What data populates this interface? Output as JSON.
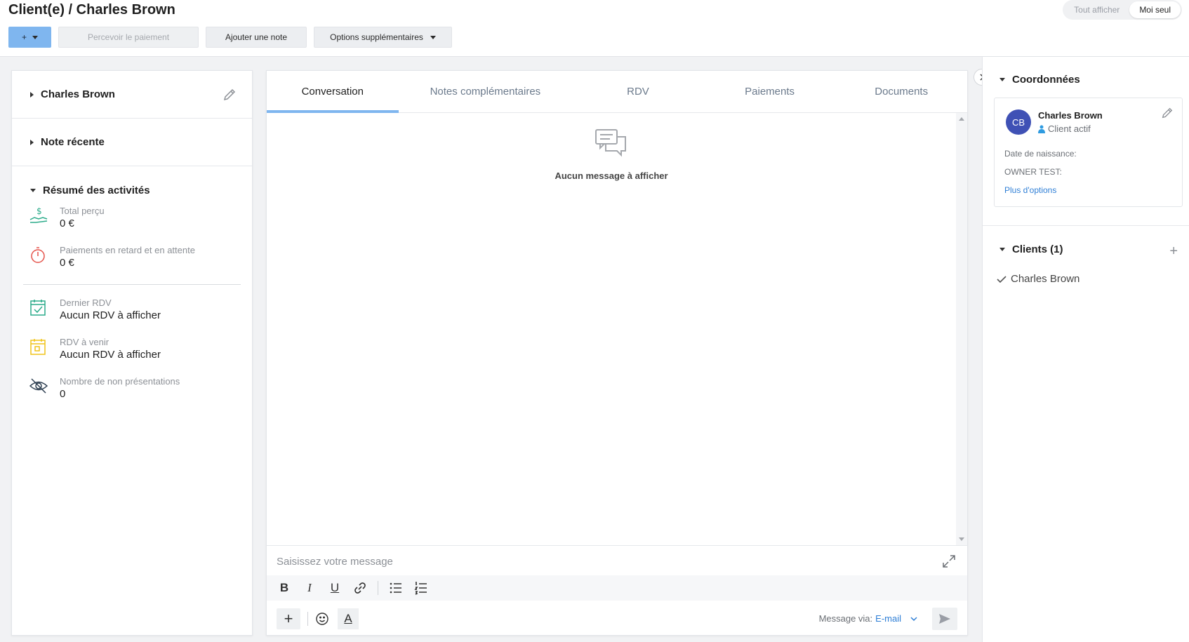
{
  "header": {
    "title": "Client(e) / Charles Brown",
    "view_toggle": {
      "show_all": "Tout afficher",
      "only_me": "Moi seul",
      "selected": "Moi seul"
    }
  },
  "toolbar": {
    "add_label": "+",
    "collect_payment": "Percevoir le paiement",
    "add_note": "Ajouter une note",
    "more_options": "Options supplémentaires"
  },
  "left": {
    "client_name": "Charles Brown",
    "recent_note": "Note récente",
    "summary_title": "Résumé des activités",
    "stats": [
      {
        "label": "Total perçu",
        "value": "0 €",
        "icon": "money-hand-icon"
      },
      {
        "label": "Paiements en retard et en attente",
        "value": "0 €",
        "icon": "stopwatch-icon"
      },
      {
        "label": "Dernier RDV",
        "value": "Aucun RDV à afficher",
        "icon": "calendar-check-icon"
      },
      {
        "label": "RDV à venir",
        "value": "Aucun RDV à afficher",
        "icon": "calendar-upcoming-icon"
      },
      {
        "label": "Nombre de non présentations",
        "value": "0",
        "icon": "eye-slash-icon"
      }
    ]
  },
  "center": {
    "tabs": [
      {
        "label": "Conversation",
        "active": true
      },
      {
        "label": "Notes complémentaires"
      },
      {
        "label": "RDV"
      },
      {
        "label": "Paiements"
      },
      {
        "label": "Documents"
      }
    ],
    "empty_message": "Aucun message à afficher",
    "composer": {
      "placeholder": "Saisissez votre message",
      "via_label": "Message via:",
      "channel": "E-mail",
      "bold": "B",
      "italic": "I",
      "underline": "U",
      "text_color": "A",
      "plus": "+"
    }
  },
  "right": {
    "contact_title": "Coordonnées",
    "avatar_initials": "CB",
    "contact_name": "Charles Brown",
    "contact_status": "Client actif",
    "birth_date_label": "Date de naissance:",
    "owner_label": "OWNER TEST:",
    "more_options": "Plus d'options",
    "clients_title": "Clients (1)",
    "add_client": "+",
    "clients": [
      "Charles Brown"
    ]
  },
  "colors": {
    "accent": "#7fb6ef",
    "link": "#2f7fd6",
    "avatar": "#3f51b5",
    "money_icon": "#2bab8a",
    "stopwatch_icon": "#e5534b",
    "calendar_check_icon": "#2bab8a",
    "calendar_upcoming_icon": "#f0c419"
  }
}
